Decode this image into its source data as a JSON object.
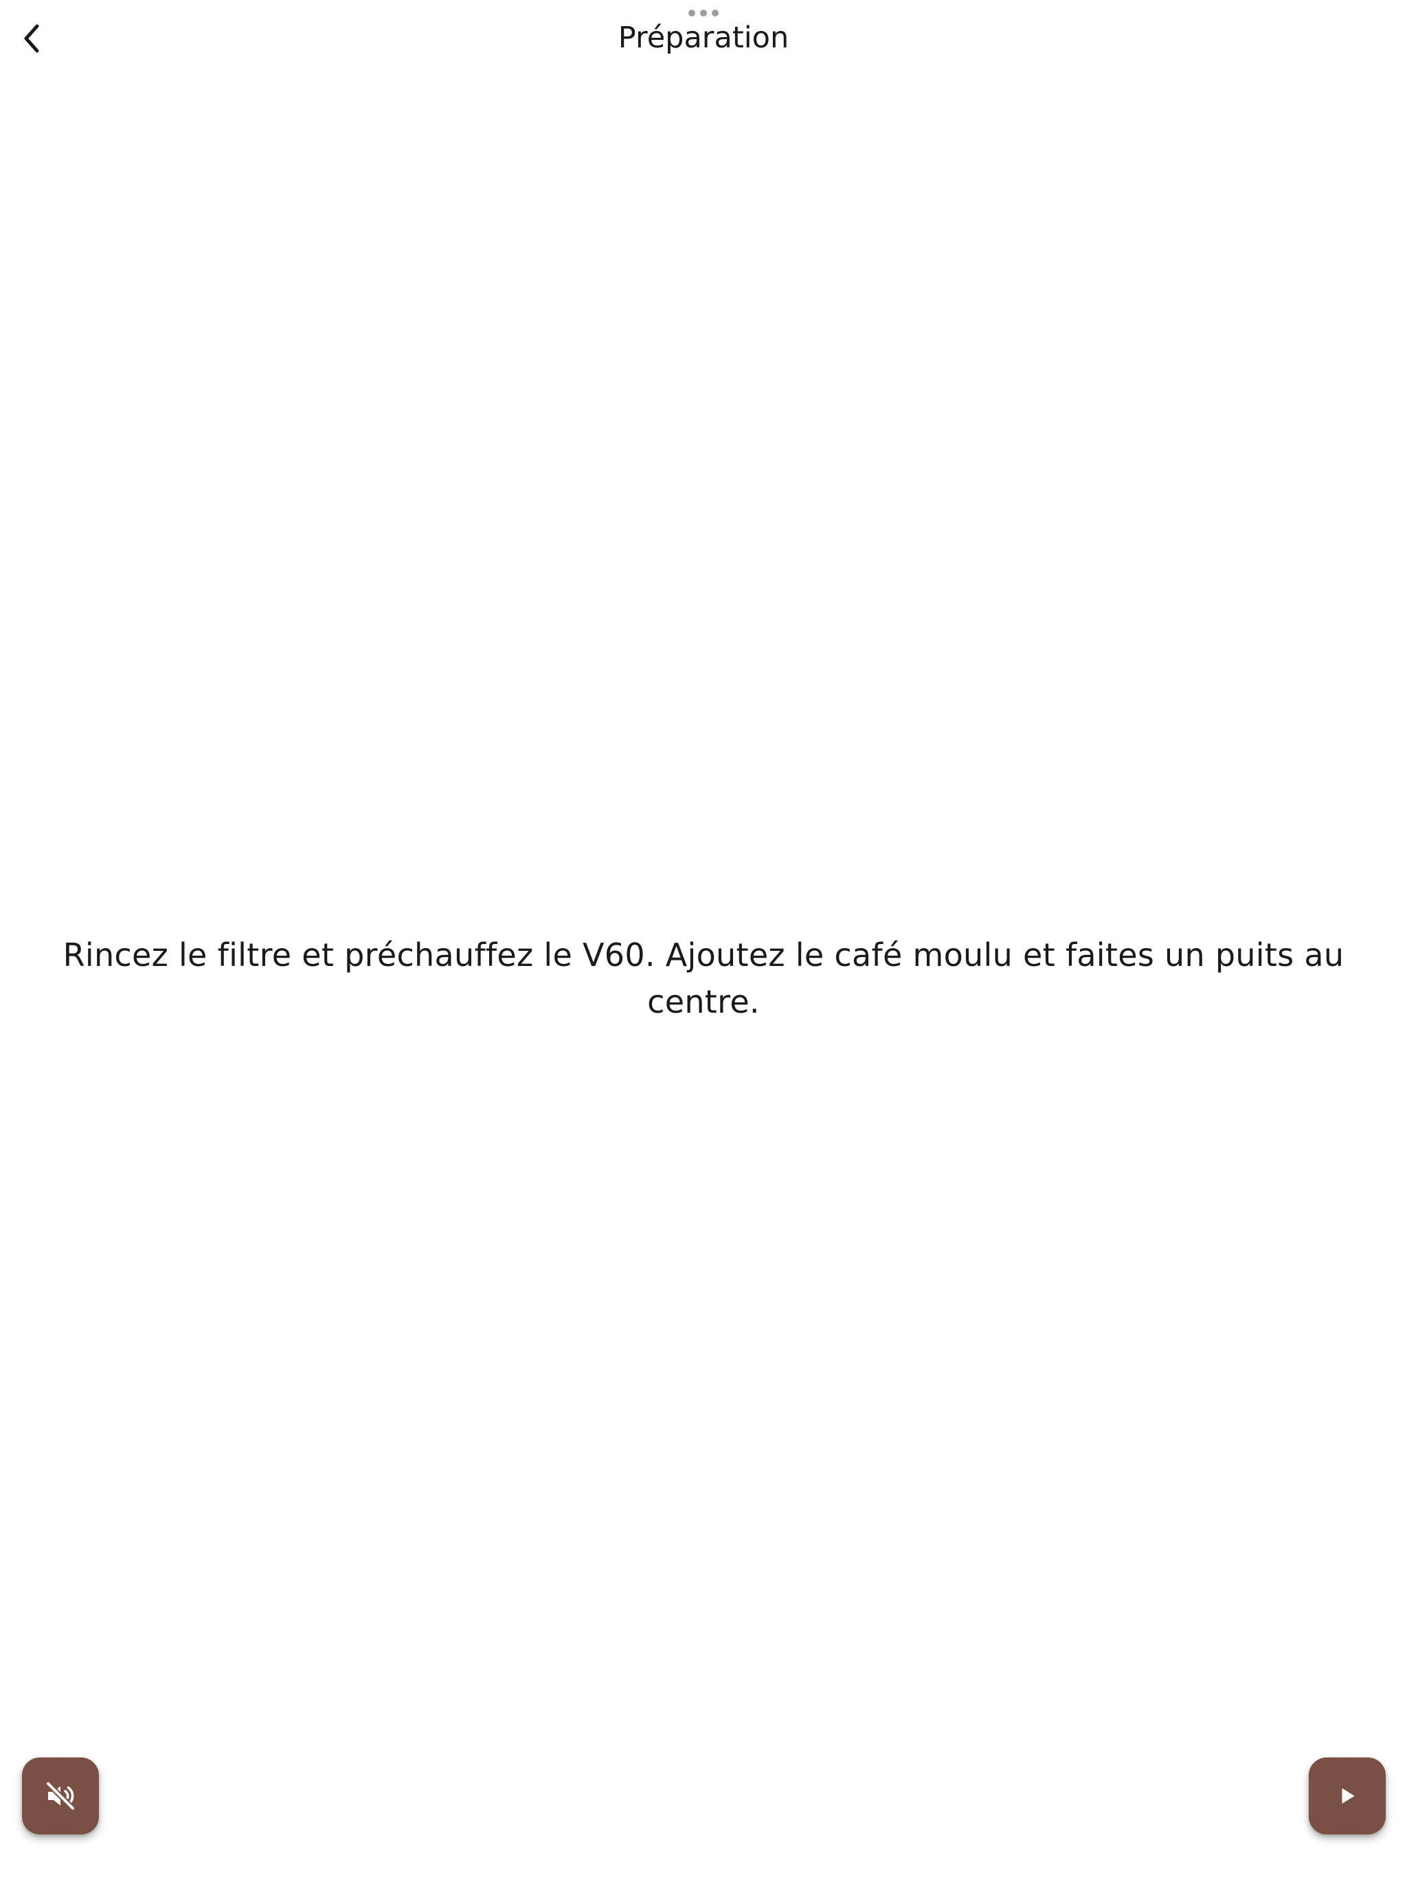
{
  "header": {
    "title": "Préparation",
    "back_icon": "chevron-left-icon",
    "multitask_icon": "more-horizontal-icon"
  },
  "main": {
    "instruction": "Rincez le filtre et préchauffez le V60. Ajoutez le café moulu et faites un puits au centre."
  },
  "controls": {
    "mute_icon": "volume-off-icon",
    "play_icon": "play-icon"
  },
  "colors": {
    "accent": "#7b5044",
    "text": "#1a1a1a",
    "background": "#ffffff"
  }
}
